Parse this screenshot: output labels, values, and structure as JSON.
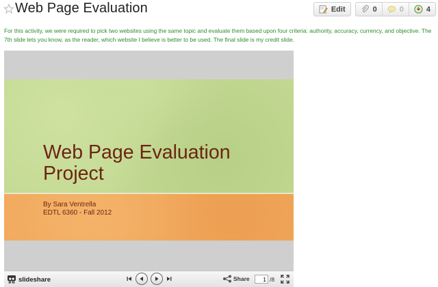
{
  "page": {
    "title": "Web Page Evaluation",
    "description": "For this activity, we were required to pick two websites using the same topic and evaluate them based upon four criteria: authority, accuracy, currency, and objective. The 7th slide lets you know, as the reader, which website I believe is better to be used. The final slide is my credit slide."
  },
  "toolbar": {
    "edit_label": "Edit",
    "attachments_count": "0",
    "comments_count": "0",
    "followers_count": "4"
  },
  "player": {
    "slide": {
      "title": "Web Page Evaluation Project",
      "author": "By Sara Ventrella",
      "course": "EDTL 6360 - Fall 2012"
    },
    "logo_text": "slideshare",
    "share_label": "Share",
    "current_page": "1",
    "total_pages": "/8"
  },
  "colors": {
    "description_text": "#2e8b2e",
    "slide_green": "#c3d993",
    "slide_orange": "#f1a85c",
    "slide_text": "#6b2512"
  },
  "icons": [
    "star-icon",
    "edit-icon",
    "attachment-icon",
    "comment-icon",
    "follow-icon",
    "slideshare-logo-icon",
    "first-slide-icon",
    "previous-slide-icon",
    "next-slide-icon",
    "last-slide-icon",
    "share-icon",
    "fullscreen-icon"
  ]
}
